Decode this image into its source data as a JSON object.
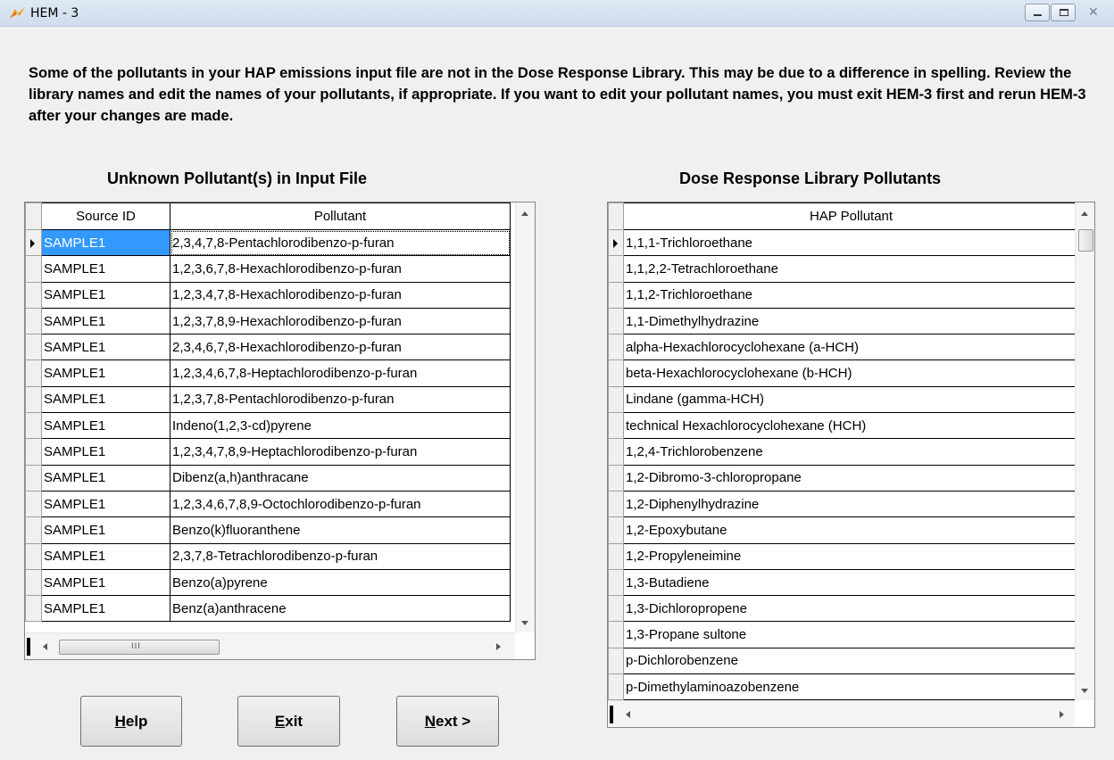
{
  "window": {
    "title": "HEM - 3",
    "icon": "hem-logo-icon"
  },
  "message": "Some of the pollutants in your HAP emissions input file are not in the Dose Response Library. This may be due to a difference in spelling. Review the library names and edit the names of your pollutants, if appropriate. If you want to edit your pollutant names, you must exit HEM-3 first and rerun HEM-3 after your changes are made.",
  "left_panel": {
    "title": "Unknown Pollutant(s) in Input File",
    "columns": [
      "Source ID",
      "Pollutant"
    ],
    "rows": [
      [
        "SAMPLE1",
        "2,3,4,7,8-Pentachlorodibenzo-p-furan"
      ],
      [
        "SAMPLE1",
        "1,2,3,6,7,8-Hexachlorodibenzo-p-furan"
      ],
      [
        "SAMPLE1",
        "1,2,3,4,7,8-Hexachlorodibenzo-p-furan"
      ],
      [
        "SAMPLE1",
        "1,2,3,7,8,9-Hexachlorodibenzo-p-furan"
      ],
      [
        "SAMPLE1",
        "2,3,4,6,7,8-Hexachlorodibenzo-p-furan"
      ],
      [
        "SAMPLE1",
        "1,2,3,4,6,7,8-Heptachlorodibenzo-p-furan"
      ],
      [
        "SAMPLE1",
        "1,2,3,7,8-Pentachlorodibenzo-p-furan"
      ],
      [
        "SAMPLE1",
        "Indeno(1,2,3-cd)pyrene"
      ],
      [
        "SAMPLE1",
        "1,2,3,4,7,8,9-Heptachlorodibenzo-p-furan"
      ],
      [
        "SAMPLE1",
        "Dibenz(a,h)anthracane"
      ],
      [
        "SAMPLE1",
        "1,2,3,4,6,7,8,9-Octochlorodibenzo-p-furan"
      ],
      [
        "SAMPLE1",
        "Benzo(k)fluoranthene"
      ],
      [
        "SAMPLE1",
        "2,3,7,8-Tetrachlorodibenzo-p-furan"
      ],
      [
        "SAMPLE1",
        "Benzo(a)pyrene"
      ],
      [
        "SAMPLE1",
        "Benz(a)anthracene"
      ]
    ],
    "scroll_grip": "III"
  },
  "right_panel": {
    "title": "Dose Response Library Pollutants",
    "columns": [
      "HAP Pollutant"
    ],
    "rows": [
      "1,1,1-Trichloroethane",
      "1,1,2,2-Tetrachloroethane",
      "1,1,2-Trichloroethane",
      "1,1-Dimethylhydrazine",
      "alpha-Hexachlorocyclohexane (a-HCH)",
      "beta-Hexachlorocyclohexane (b-HCH)",
      "Lindane (gamma-HCH)",
      "technical Hexachlorocyclohexane (HCH)",
      "1,2,4-Trichlorobenzene",
      "1,2-Dibromo-3-chloropropane",
      "1,2-Diphenylhydrazine",
      "1,2-Epoxybutane",
      "1,2-Propyleneimine",
      "1,3-Butadiene",
      "1,3-Dichloropropene",
      "1,3-Propane sultone",
      "p-Dichlorobenzene",
      "p-Dimethylaminoazobenzene"
    ]
  },
  "buttons": {
    "help": {
      "mnemonic": "H",
      "rest": "elp"
    },
    "exit": {
      "mnemonic": "E",
      "rest": "xit"
    },
    "next": {
      "mnemonic": "N",
      "rest": "ext >"
    }
  }
}
